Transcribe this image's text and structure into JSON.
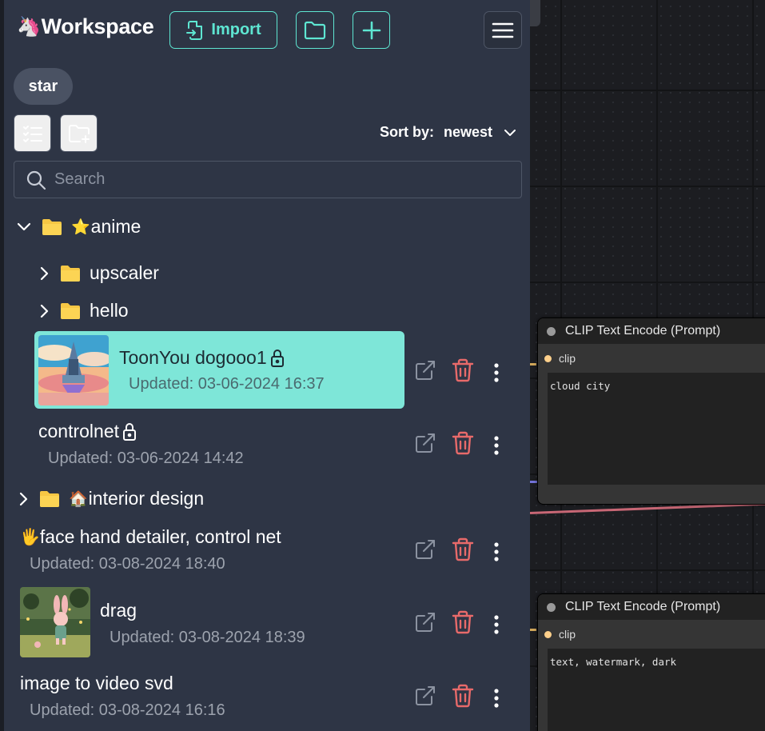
{
  "app": {
    "brand": "Workspace",
    "brand_emoji": "🦄"
  },
  "toolbar": {
    "import_label": "Import"
  },
  "tag_chip": "star",
  "sort": {
    "label": "Sort by:",
    "value": "newest"
  },
  "search": {
    "placeholder": "Search"
  },
  "tree": {
    "folder_anime": {
      "emoji": "⭐",
      "name": "anime"
    },
    "folder_upscaler": "upscaler",
    "folder_hello": "hello",
    "folder_interior": {
      "emoji": "🏠",
      "name": "interior design"
    }
  },
  "workflows": [
    {
      "title": "ToonYou dogooo1",
      "updated": "Updated: 03-06-2024 16:37",
      "locked": true,
      "active": true
    },
    {
      "title": "controlnet",
      "updated": "Updated: 03-06-2024 14:42",
      "locked": true
    },
    {
      "emoji": "🖐",
      "title": "face hand detailer, control net",
      "updated": "Updated: 03-08-2024 18:40"
    },
    {
      "title": "drag",
      "updated": "Updated: 03-08-2024 18:39"
    },
    {
      "title": "image to video svd",
      "updated": "Updated: 03-08-2024 16:16"
    }
  ],
  "canvas_nodes": [
    {
      "title": "CLIP Text Encode (Prompt)",
      "input": "clip",
      "text": "cloud city"
    },
    {
      "title": "CLIP Text Encode (Prompt)",
      "input": "clip",
      "text": "text, watermark, dark"
    }
  ],
  "colors": {
    "accent": "#5ee6d2",
    "active_bg": "#7ee6d8",
    "danger": "#e86a6a",
    "sidebar_bg": "#2e3545"
  }
}
